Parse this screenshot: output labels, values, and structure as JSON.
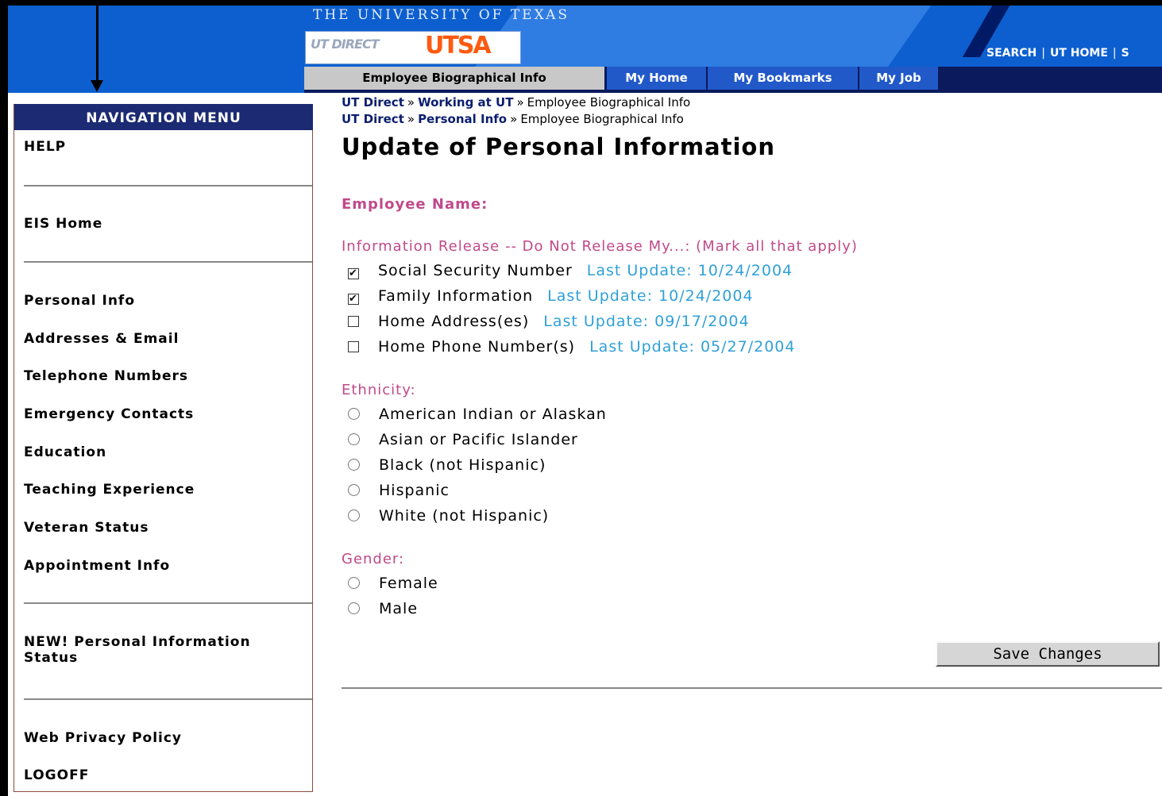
{
  "header": {
    "university_title": "THE UNIVERSITY OF TEXAS",
    "logo_utdirect": "UT DIRECT",
    "logo_utsa": "UTSA",
    "links": [
      "SEARCH",
      "UT HOME",
      "S"
    ]
  },
  "tabs": [
    {
      "label": "Employee Biographical Info",
      "active": true
    },
    {
      "label": "My Home",
      "active": false
    },
    {
      "label": "My Bookmarks",
      "active": false
    },
    {
      "label": "My Job",
      "active": false
    }
  ],
  "nav": {
    "header": "NAVIGATION MENU",
    "items": {
      "help": "HELP",
      "eis_home": "EIS Home",
      "personal_info": "Personal Info",
      "addresses": "Addresses & Email",
      "telephone": "Telephone Numbers",
      "emergency": "Emergency Contacts",
      "education": "Education",
      "teaching": "Teaching Experience",
      "veteran": "Veteran Status",
      "appointment": "Appointment Info",
      "new_status_line1": "NEW! Personal Information",
      "new_status_line2": "Status",
      "privacy": "Web Privacy Policy",
      "logoff": "LOGOFF"
    }
  },
  "breadcrumbs": [
    {
      "links": [
        "UT Direct",
        "Working at UT"
      ],
      "current": "Employee Biographical Info"
    },
    {
      "links": [
        "UT Direct",
        "Personal Info"
      ],
      "current": "Employee Biographical Info"
    }
  ],
  "breadcrumb_separator": "»",
  "page_title": "Update of Personal Information",
  "employee_name_label": "Employee Name:",
  "info_release": {
    "label": "Information Release -- Do Not Release My...: (Mark all that apply)",
    "options": [
      {
        "label": "Social Security Number",
        "checked": true,
        "update": "Last Update: 10/24/2004"
      },
      {
        "label": "Family Information",
        "checked": true,
        "update": "Last Update: 10/24/2004"
      },
      {
        "label": "Home Address(es)",
        "checked": false,
        "update": "Last Update: 09/17/2004"
      },
      {
        "label": "Home Phone Number(s)",
        "checked": false,
        "update": "Last Update: 05/27/2004"
      }
    ]
  },
  "ethnicity": {
    "label": "Ethnicity:",
    "options": [
      "American Indian or Alaskan",
      "Asian or Pacific Islander",
      "Black (not Hispanic)",
      "Hispanic",
      "White (not Hispanic)"
    ]
  },
  "gender": {
    "label": "Gender:",
    "options": [
      "Female",
      "Male"
    ]
  },
  "save_button": "Save Changes",
  "check_mark": "✔",
  "colors": {
    "header_blue": "#0d5fcf",
    "nav_header": "#1b2a73",
    "label_pink": "#c04a8a",
    "update_blue": "#2fa0d8",
    "logo_orange": "#ff5a10"
  }
}
